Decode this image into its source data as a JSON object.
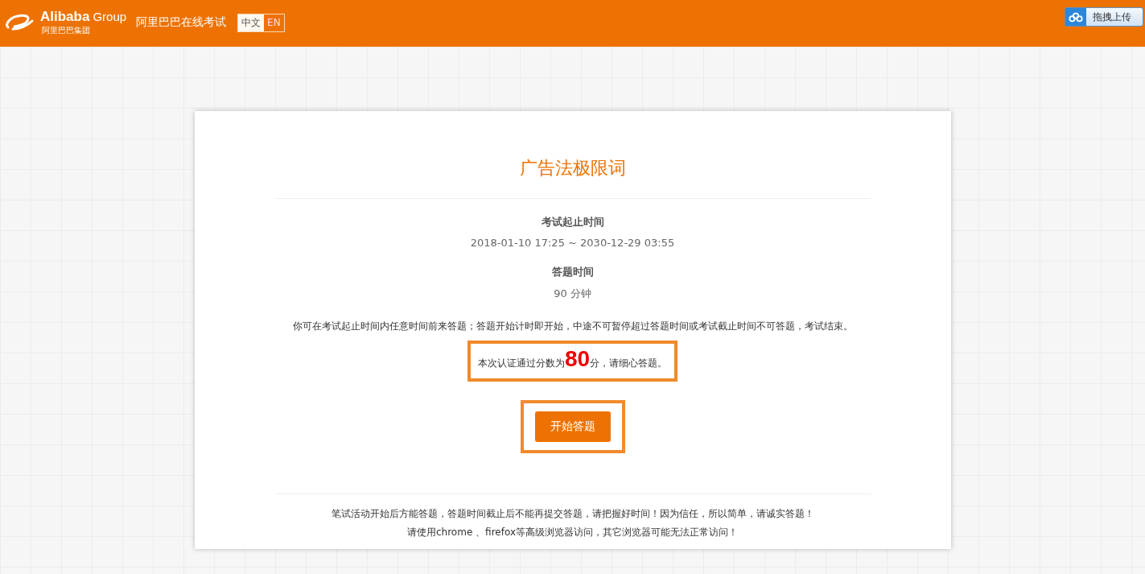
{
  "header": {
    "logo_text": "Alibaba",
    "logo_suffix": "Group",
    "logo_cn": "阿里巴巴集团",
    "site_title": "阿里巴巴在线考试",
    "languages": [
      {
        "label": "中文",
        "selected": true
      },
      {
        "label": "EN",
        "selected": false
      }
    ],
    "upload_button": "拖拽上传"
  },
  "exam": {
    "title": "广告法极限词",
    "period_label": "考试起止时间",
    "period_value": "2018-01-10 17:25 ~ 2030-12-29 03:55",
    "duration_label": "答题时间",
    "duration_value": "90 分钟",
    "rules": "你可在考试起止时间内任意时间前来答题；答题开始计时即开始，中途不可暂停超过答题时间或考试截止时间不可答题，考试结束。",
    "pass_note": "本次认证通过分数为**80**分，请细心答题。",
    "start_button": "开始答题",
    "footer_lines": [
      "笔试活动开始后方能答题，答题时间截止后不能再提交答题，请把握好时间！因为信任，所以简单，请诚实答题！",
      "请使用chrome 、firefox等高级浏览器访问，其它浏览器可能无法正常访问！"
    ]
  }
}
